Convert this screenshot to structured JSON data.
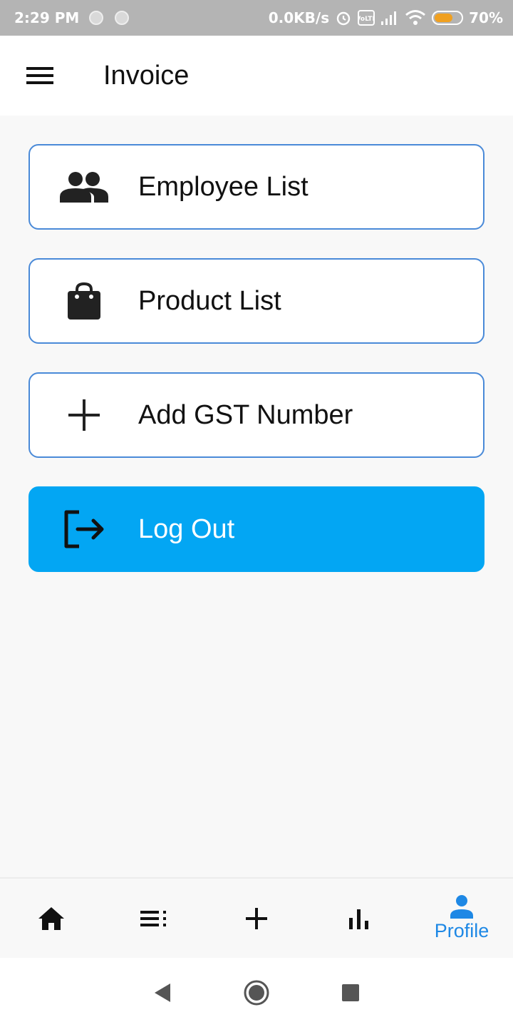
{
  "status_bar": {
    "time": "2:29 PM",
    "net_speed": "0.0KB/s",
    "battery": "70%",
    "battery_level": 0.7
  },
  "app_bar": {
    "title": "Invoice",
    "menu_icon": "hamburger-menu-icon"
  },
  "menu": [
    {
      "label": "Employee List",
      "icon": "people-icon"
    },
    {
      "label": "Product List",
      "icon": "shopping-bag-icon"
    },
    {
      "label": "Add GST Number",
      "icon": "plus-icon"
    },
    {
      "label": "Log Out",
      "icon": "logout-icon"
    }
  ],
  "bottom_nav": [
    {
      "icon": "home-icon",
      "label": ""
    },
    {
      "icon": "list-icon",
      "label": ""
    },
    {
      "icon": "add-icon",
      "label": ""
    },
    {
      "icon": "bar-chart-icon",
      "label": ""
    },
    {
      "icon": "person-icon",
      "label": "Profile",
      "active": true
    }
  ],
  "colors": {
    "accent": "#03a6f3",
    "card_border": "#4a8ad8",
    "active_nav": "#1e88e5"
  }
}
